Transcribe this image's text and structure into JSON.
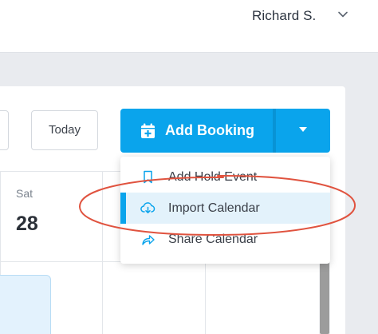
{
  "header": {
    "user_name": "Richard S.",
    "user_menu_icon": "chevron-down-icon"
  },
  "toolbar": {
    "today_label": "Today",
    "add_booking_label": "Add Booking",
    "add_booking_icon": "calendar-plus-icon",
    "dropdown_icon": "caret-down-icon",
    "accent_color": "#0aa4ec"
  },
  "calendar": {
    "day_name": "Sat",
    "day_number": "28"
  },
  "dropdown": {
    "items": [
      {
        "label": "Add Hold Event",
        "icon": "bookmark-icon",
        "active": false
      },
      {
        "label": "Import Calendar",
        "icon": "cloud-download-icon",
        "active": true
      },
      {
        "label": "Share Calendar",
        "icon": "share-arrow-icon",
        "active": false
      }
    ]
  },
  "annotation": {
    "highlight_color": "#e0533f"
  }
}
